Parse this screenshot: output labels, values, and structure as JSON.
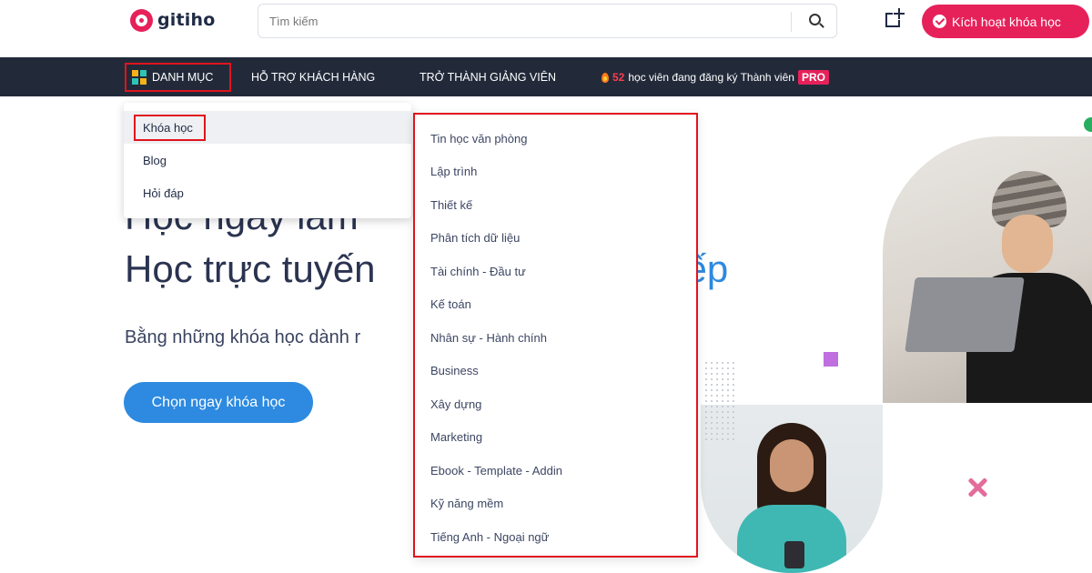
{
  "header": {
    "logo_text": "gitiho",
    "search_placeholder": "Tìm kiếm",
    "activate_label": "Kích hoạt khóa học"
  },
  "navbar": {
    "category_label": "DANH MỤC",
    "support_label": "HỖ TRỢ KHÁCH HÀNG",
    "instructor_label": "TRỞ THÀNH GIẢNG VIÊN",
    "promo_count": "52",
    "promo_text": "học viên đang đăng ký Thành viên",
    "promo_badge": "PRO"
  },
  "hero": {
    "line1": "Học ngay làm",
    "line2_start": "Học trực tuyến",
    "line2_accent": "tiếp",
    "subtitle": "Bằng những khóa học dành r",
    "cta_label": "Chọn ngay khóa học"
  },
  "menu": {
    "main_items": [
      "Khóa học",
      "Blog",
      "Hỏi đáp"
    ],
    "sub_items": [
      "Tin học văn phòng",
      "Lập trình",
      "Thiết kế",
      "Phân tích dữ liệu",
      "Tài chính - Đầu tư",
      "Kế toán",
      "Nhân sự - Hành chính",
      "Business",
      "Xây dựng",
      "Marketing",
      "Ebook - Template - Addin",
      "Kỹ năng mềm",
      "Tiếng Anh - Ngoại ngữ"
    ]
  },
  "colors": {
    "brand": "#e6215a",
    "navbar": "#222a3a",
    "accent_blue": "#2d8ae0",
    "highlight_red": "#e0141e"
  }
}
